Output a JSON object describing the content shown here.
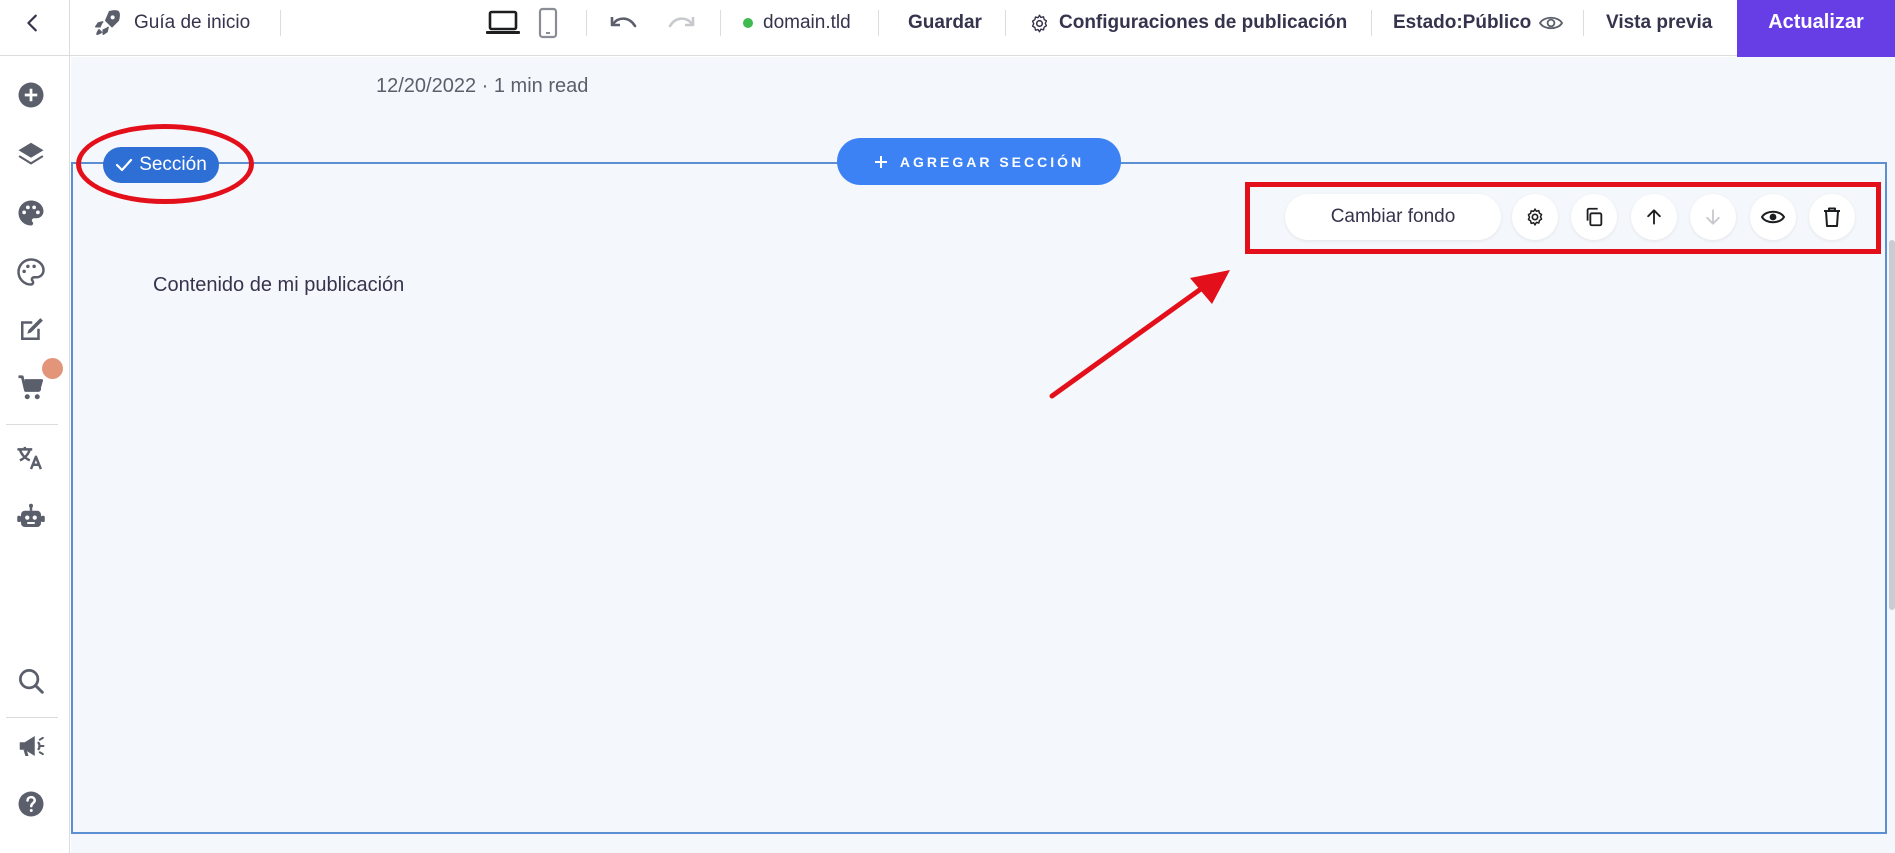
{
  "topbar": {
    "start_guide": "Guía de inicio",
    "domain": "domain.tld",
    "save": "Guardar",
    "publish_settings": "Configuraciones de publicación",
    "status": "Estado:Público",
    "preview": "Vista previa",
    "update": "Actualizar"
  },
  "post": {
    "date_line": "12/20/2022 · 1 min read",
    "content": "Contenido de mi publicación"
  },
  "section": {
    "tag_label": "Sección",
    "add_section_label": "AGREGAR SECCIÓN",
    "change_background": "Cambiar fondo"
  },
  "colors": {
    "accent": "#673de6",
    "primary_blue": "#3d82f5",
    "section_tag": "#2e6fd6",
    "status_dot": "#3fb950",
    "annotation_red": "#e3101b"
  },
  "icons": {
    "sidebar": [
      "add-icon",
      "layers-icon",
      "palette-icon",
      "theme-icon",
      "edit-icon",
      "cart-icon",
      "translate-icon",
      "robot-icon",
      "search-icon",
      "megaphone-icon",
      "help-icon"
    ],
    "toolbar": [
      "settings-icon",
      "duplicate-icon",
      "arrow-up-icon",
      "arrow-down-icon",
      "eye-icon",
      "trash-icon"
    ]
  }
}
